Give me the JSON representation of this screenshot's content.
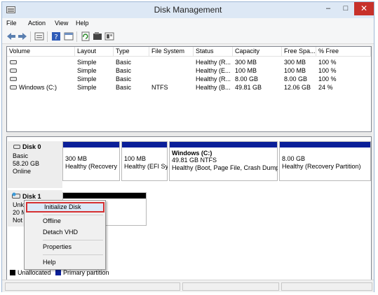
{
  "window": {
    "title": "Disk Management"
  },
  "titlebar": {
    "minimize": "–",
    "maximize": "□",
    "close": "✕"
  },
  "menu": [
    "File",
    "Action",
    "View",
    "Help"
  ],
  "toolbar": {
    "icons": [
      "back-arrow-icon",
      "forward-arrow-icon",
      "disk-list-icon",
      "help-icon",
      "properties-icon",
      "refresh-icon",
      "console-icon",
      "settings-icon"
    ]
  },
  "volumes": {
    "columns": [
      "Volume",
      "Layout",
      "Type",
      "File System",
      "Status",
      "Capacity",
      "Free Spa...",
      "% Free"
    ],
    "rows": [
      [
        "",
        "Simple",
        "Basic",
        "",
        "Healthy (R...",
        "300 MB",
        "300 MB",
        "100 %"
      ],
      [
        "",
        "Simple",
        "Basic",
        "",
        "Healthy (E...",
        "100 MB",
        "100 MB",
        "100 %"
      ],
      [
        "",
        "Simple",
        "Basic",
        "",
        "Healthy (R...",
        "8.00 GB",
        "8.00 GB",
        "100 %"
      ],
      [
        "Windows (C:)",
        "Simple",
        "Basic",
        "NTFS",
        "Healthy (B...",
        "49.81 GB",
        "12.06 GB",
        "24 %"
      ]
    ]
  },
  "disk0": {
    "name": "Disk 0",
    "type": "Basic",
    "size": "58.20 GB",
    "state": "Online",
    "partitions": [
      {
        "title": "",
        "size": "300 MB",
        "status": "Healthy (Recovery"
      },
      {
        "title": "",
        "size": "100 MB",
        "status": "Healthy (EFI Sy"
      },
      {
        "title": "Windows  (C:)",
        "size": "49.81 GB NTFS",
        "status": "Healthy (Boot, Page File, Crash Dump,"
      },
      {
        "title": "",
        "size": "8.00 GB",
        "status": "Healthy (Recovery Partition)"
      }
    ]
  },
  "disk1": {
    "name": "Disk 1",
    "type": "Unkn",
    "size": "20 M",
    "state": "Not I"
  },
  "context_menu": {
    "items": [
      "Initialize Disk",
      "Offline",
      "Detach VHD",
      "Properties",
      "Help"
    ]
  },
  "legend": [
    {
      "label": "Unallocated",
      "color": "#000000"
    },
    {
      "label": "Primary partition",
      "color": "#0a1f99"
    }
  ],
  "colors": {
    "primary": "#0a1f99",
    "unallocated": "#000000",
    "highlight_border": "#d63031",
    "close": "#c7312a"
  }
}
